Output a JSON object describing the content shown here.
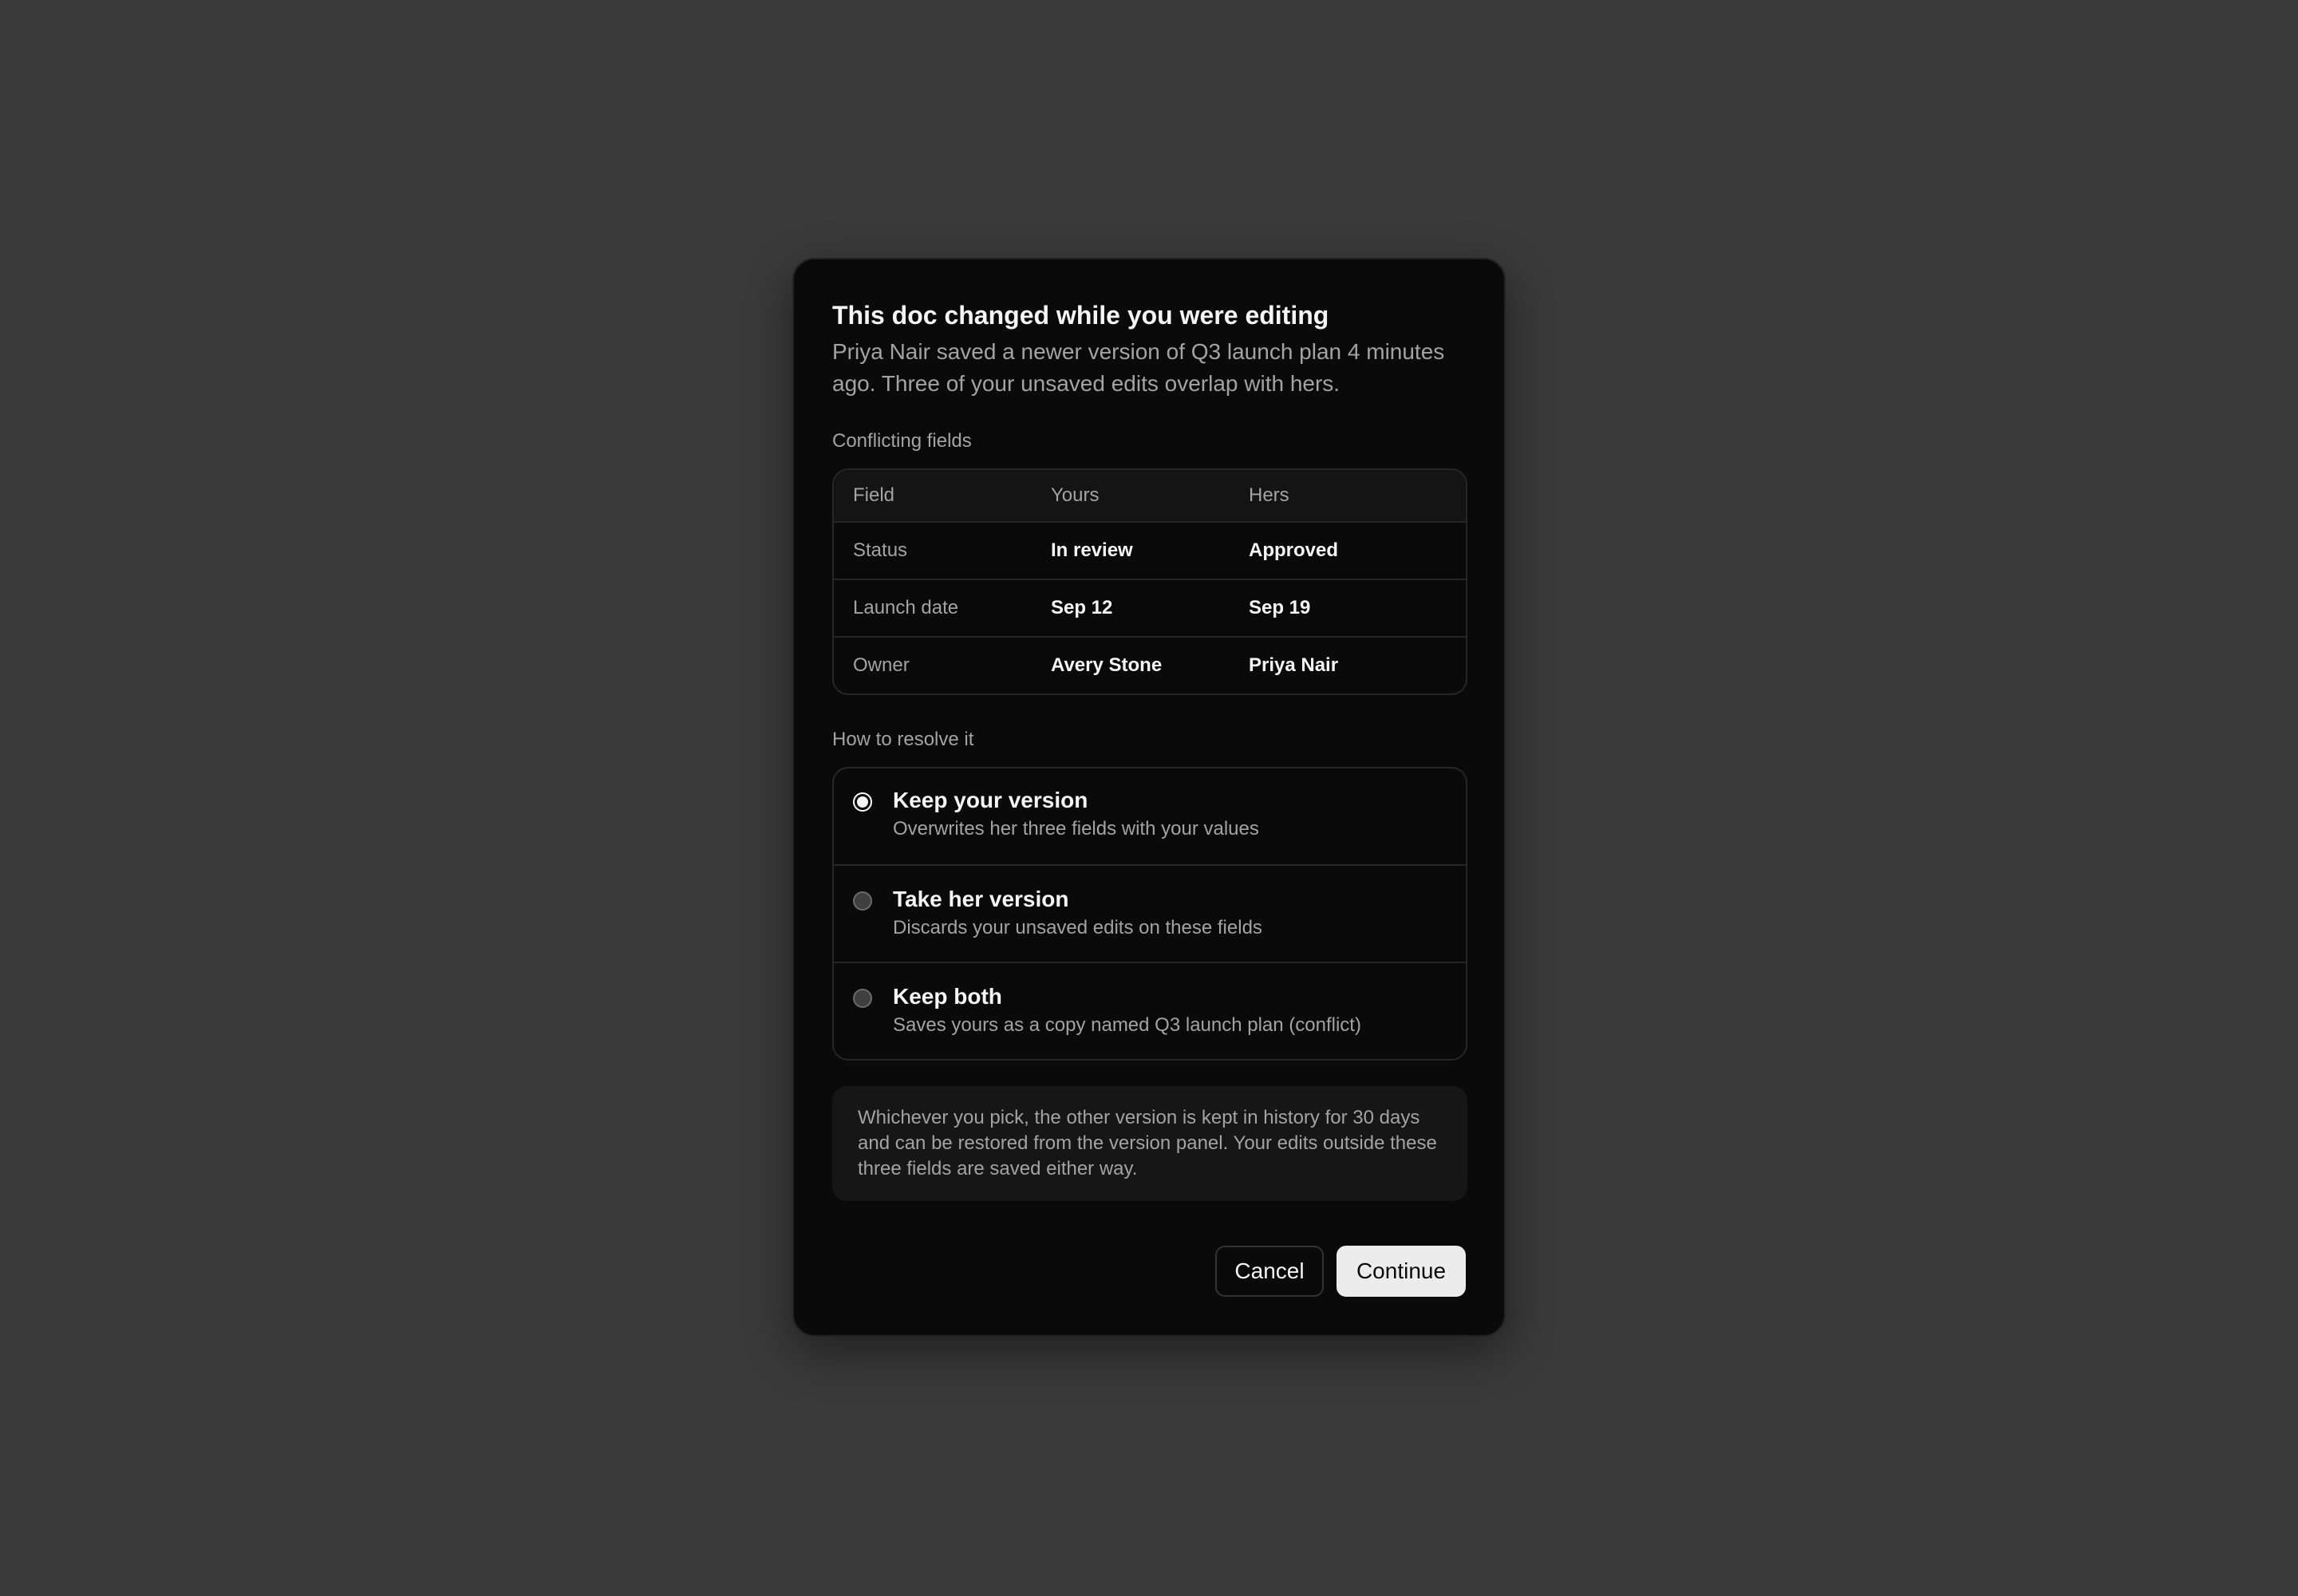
{
  "dialog": {
    "title": "This doc changed while you were editing",
    "description": "Priya Nair saved a newer version of Q3 launch plan 4 minutes ago. Three of your unsaved edits overlap with hers.",
    "conflicts_label": "Conflicting fields",
    "table": {
      "headers": [
        "Field",
        "Yours",
        "Hers"
      ],
      "rows": [
        {
          "field": "Status",
          "yours": "In review",
          "hers": "Approved"
        },
        {
          "field": "Launch date",
          "yours": "Sep 12",
          "hers": "Sep 19"
        },
        {
          "field": "Owner",
          "yours": "Avery Stone",
          "hers": "Priya Nair"
        }
      ]
    },
    "resolve_label": "How to resolve it",
    "options": [
      {
        "title": "Keep your version",
        "description": "Overwrites her three fields with your values",
        "selected": true
      },
      {
        "title": "Take her version",
        "description": "Discards your unsaved edits on these fields",
        "selected": false
      },
      {
        "title": "Keep both",
        "description": "Saves yours as a copy named Q3 launch plan (conflict)",
        "selected": false
      }
    ],
    "note": "Whichever you pick, the other version is kept in history for 30 days and can be restored from the version panel. Your edits outside these three fields are saved either way.",
    "cancel_label": "Cancel",
    "continue_label": "Continue"
  },
  "colors": {
    "backdrop": "#3a3a3a",
    "dialog_bg": "#0a0a0a",
    "primary_button_bg": "#ececec",
    "muted_text": "#a3a3a3"
  }
}
